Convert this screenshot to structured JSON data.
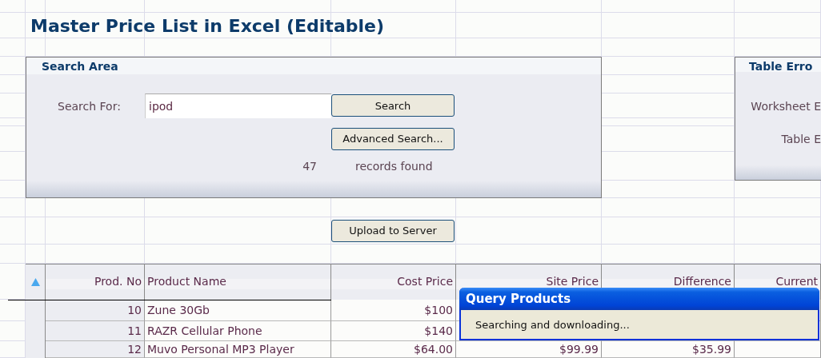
{
  "title": "Master Price List in Excel (Editable)",
  "search_area": {
    "title": "Search Area",
    "label": "Search For:",
    "value": "ipod",
    "buttons": [
      "Search",
      "Advanced Search..."
    ],
    "count": "47",
    "count_label": "records found"
  },
  "upload_button": "Upload to Server",
  "table_errors": {
    "title": "Table Erro",
    "labels": [
      "Worksheet E",
      "Table E"
    ]
  },
  "table": {
    "columns": [
      "Prod. No",
      "Product Name",
      "Cost Price",
      "Site Price",
      "Difference",
      "Current"
    ],
    "rows": [
      {
        "cells": [
          "10",
          "Zune 30Gb",
          "$100"
        ]
      },
      {
        "cells": [
          "11",
          "RAZR Cellular Phone",
          "$140"
        ]
      },
      {
        "cells": [
          "12",
          "Muvo Personal MP3 Player",
          "$64.00",
          "$99.99",
          "$35.99"
        ]
      }
    ]
  },
  "dialog": {
    "title": "Query Products",
    "message": "Searching and downloading..."
  }
}
